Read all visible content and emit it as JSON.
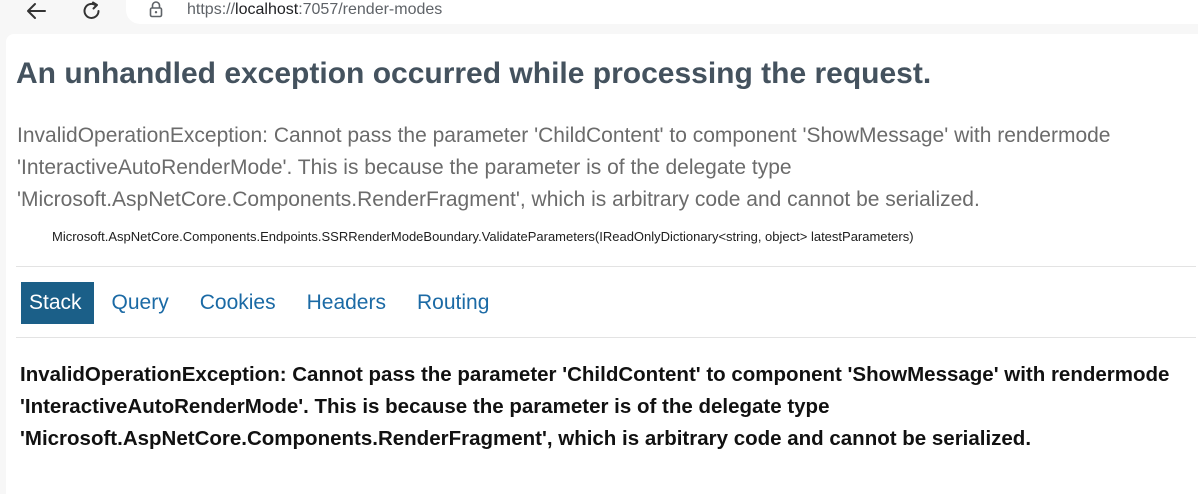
{
  "browser": {
    "url_prefix": "https://",
    "url_host": "localhost",
    "url_rest": ":7057/render-modes",
    "back_icon": "arrow-left-icon",
    "reload_icon": "reload-icon",
    "lock_icon": "lock-icon"
  },
  "error": {
    "title": "An unhandled exception occurred while processing the request.",
    "message": "InvalidOperationException: Cannot pass the parameter 'ChildContent' to component 'ShowMessage' with rendermode 'InteractiveAutoRenderMode'. This is because the parameter is of the delegate type 'Microsoft.AspNetCore.Components.RenderFragment', which is arbitrary code and cannot be serialized.",
    "location": "Microsoft.AspNetCore.Components.Endpoints.SSRRenderModeBoundary.ValidateParameters(IReadOnlyDictionary<string, object> latestParameters)"
  },
  "tabs": [
    {
      "label": "Stack",
      "active": true
    },
    {
      "label": "Query",
      "active": false
    },
    {
      "label": "Cookies",
      "active": false
    },
    {
      "label": "Headers",
      "active": false
    },
    {
      "label": "Routing",
      "active": false
    }
  ],
  "stack": {
    "message": "InvalidOperationException: Cannot pass the parameter 'ChildContent' to component 'ShowMessage' with rendermode 'InteractiveAutoRenderMode'. This is because the parameter is of the delegate type 'Microsoft.AspNetCore.Components.RenderFragment', which is arbitrary code and cannot be serialized."
  },
  "colors": {
    "title": "#44525e",
    "tab_link": "#1b6aa5",
    "tab_active_bg": "#1b5f88"
  }
}
